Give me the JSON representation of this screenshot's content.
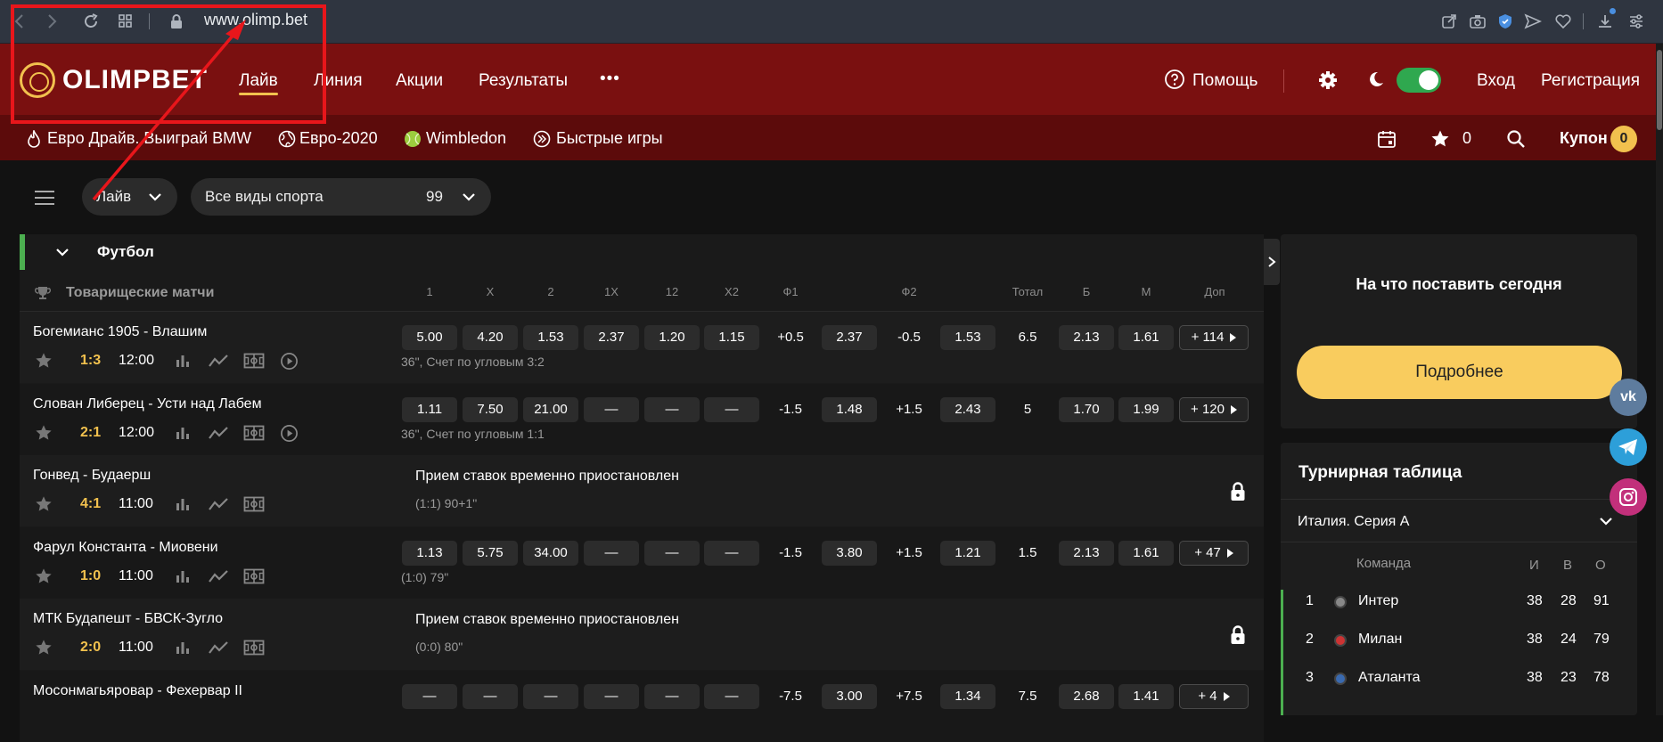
{
  "browser": {
    "url": "www.olimp.bet"
  },
  "logo": {
    "text": "OLIMPBET"
  },
  "nav": {
    "items": [
      "Лайв",
      "Линия",
      "Акции",
      "Результаты"
    ],
    "more": "•••"
  },
  "header_right": {
    "help": "Помощь",
    "login": "Вход",
    "register": "Регистрация"
  },
  "subnav": {
    "items": [
      "Евро Драйв. Выиграй BMW",
      "Евро-2020",
      "Wimbledon",
      "Быстрые игры"
    ],
    "favorites_count": "0",
    "coupon_label": "Купон",
    "coupon_count": "0"
  },
  "filters": {
    "mode": "Лайв",
    "sport": "Все виды спорта",
    "sport_count": "99"
  },
  "sport": {
    "name": "Футбол"
  },
  "league": {
    "name": "Товарищеские матчи",
    "columns": [
      "1",
      "X",
      "2",
      "1X",
      "12",
      "X2",
      "Ф1",
      "Ф2",
      "Тотал",
      "Б",
      "М",
      "Доп"
    ]
  },
  "matches": [
    {
      "name": "Богемианс 1905 - Влашим",
      "score": "1:3",
      "time": "12:00",
      "info": "36\", Счет по угловым 3:2",
      "odds": [
        "5.00",
        "4.20",
        "1.53",
        "2.37",
        "1.20",
        "1.15"
      ],
      "f1": "+0.5",
      "f1o": "2.37",
      "f2": "-0.5",
      "f2o": "1.53",
      "total": "6.5",
      "b": "2.13",
      "m": "1.61",
      "more": "+ 114"
    },
    {
      "name": "Слован Либерец - Усти над Лабем",
      "score": "2:1",
      "time": "12:00",
      "info": "36\", Счет по угловым 1:1",
      "odds": [
        "1.11",
        "7.50",
        "21.00",
        "—",
        "—",
        "—"
      ],
      "f1": "-1.5",
      "f1o": "1.48",
      "f2": "+1.5",
      "f2o": "2.43",
      "total": "5",
      "b": "1.70",
      "m": "1.99",
      "more": "+ 120"
    },
    {
      "name": "Гонвед - Будаерш",
      "score": "4:1",
      "time": "11:00",
      "suspended": "Прием ставок временно приостановлен",
      "info": "(1:1) 90+1\""
    },
    {
      "name": "Фарул Константа - Миовени",
      "score": "1:0",
      "time": "11:00",
      "info": "(1:0) 79\"",
      "odds": [
        "1.13",
        "5.75",
        "34.00",
        "—",
        "—",
        "—"
      ],
      "f1": "-1.5",
      "f1o": "3.80",
      "f2": "+1.5",
      "f2o": "1.21",
      "total": "1.5",
      "b": "2.13",
      "m": "1.61",
      "more": "+ 47"
    },
    {
      "name": "МТК Будапешт - БВСК-Зугло",
      "score": "2:0",
      "time": "11:00",
      "suspended": "Прием ставок временно приостановлен",
      "info": "(0:0) 80\""
    },
    {
      "name": "Мосонмагьяровар - Фехервар II",
      "odds": [
        "—",
        "—",
        "—",
        "—",
        "—",
        "—"
      ],
      "f1": "-7.5",
      "f1o": "3.00",
      "f2": "+7.5",
      "f2o": "1.34",
      "total": "7.5",
      "b": "2.68",
      "m": "1.41",
      "more": "+ 4"
    }
  ],
  "promo": {
    "title": "На что поставить сегодня",
    "button": "Подробнее"
  },
  "standings": {
    "title": "Турнирная таблица",
    "league": "Италия. Серия А",
    "header": {
      "team": "Команда",
      "g": "И",
      "w": "В",
      "p": "О"
    },
    "rows": [
      {
        "pos": "1",
        "team": "Интер",
        "g": "38",
        "w": "28",
        "p": "91"
      },
      {
        "pos": "2",
        "team": "Милан",
        "g": "38",
        "w": "24",
        "p": "79"
      },
      {
        "pos": "3",
        "team": "Аталанта",
        "g": "38",
        "w": "23",
        "p": "78"
      }
    ]
  },
  "colors": {
    "header": "#7a1010",
    "subheader": "#5c0b0b",
    "accent": "#f2c14e",
    "toggle": "#2fa84f",
    "annotation": "#e8161b"
  }
}
